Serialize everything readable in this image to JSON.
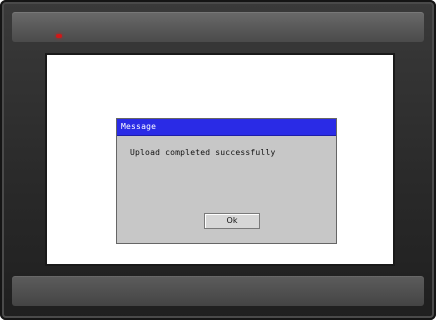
{
  "dialog": {
    "title": "Message",
    "message": "Upload completed successfully",
    "ok_label": "Ok"
  },
  "colors": {
    "titlebar": "#2a2be6",
    "dialog_bg": "#c7c7c7",
    "led": "#d01818"
  }
}
